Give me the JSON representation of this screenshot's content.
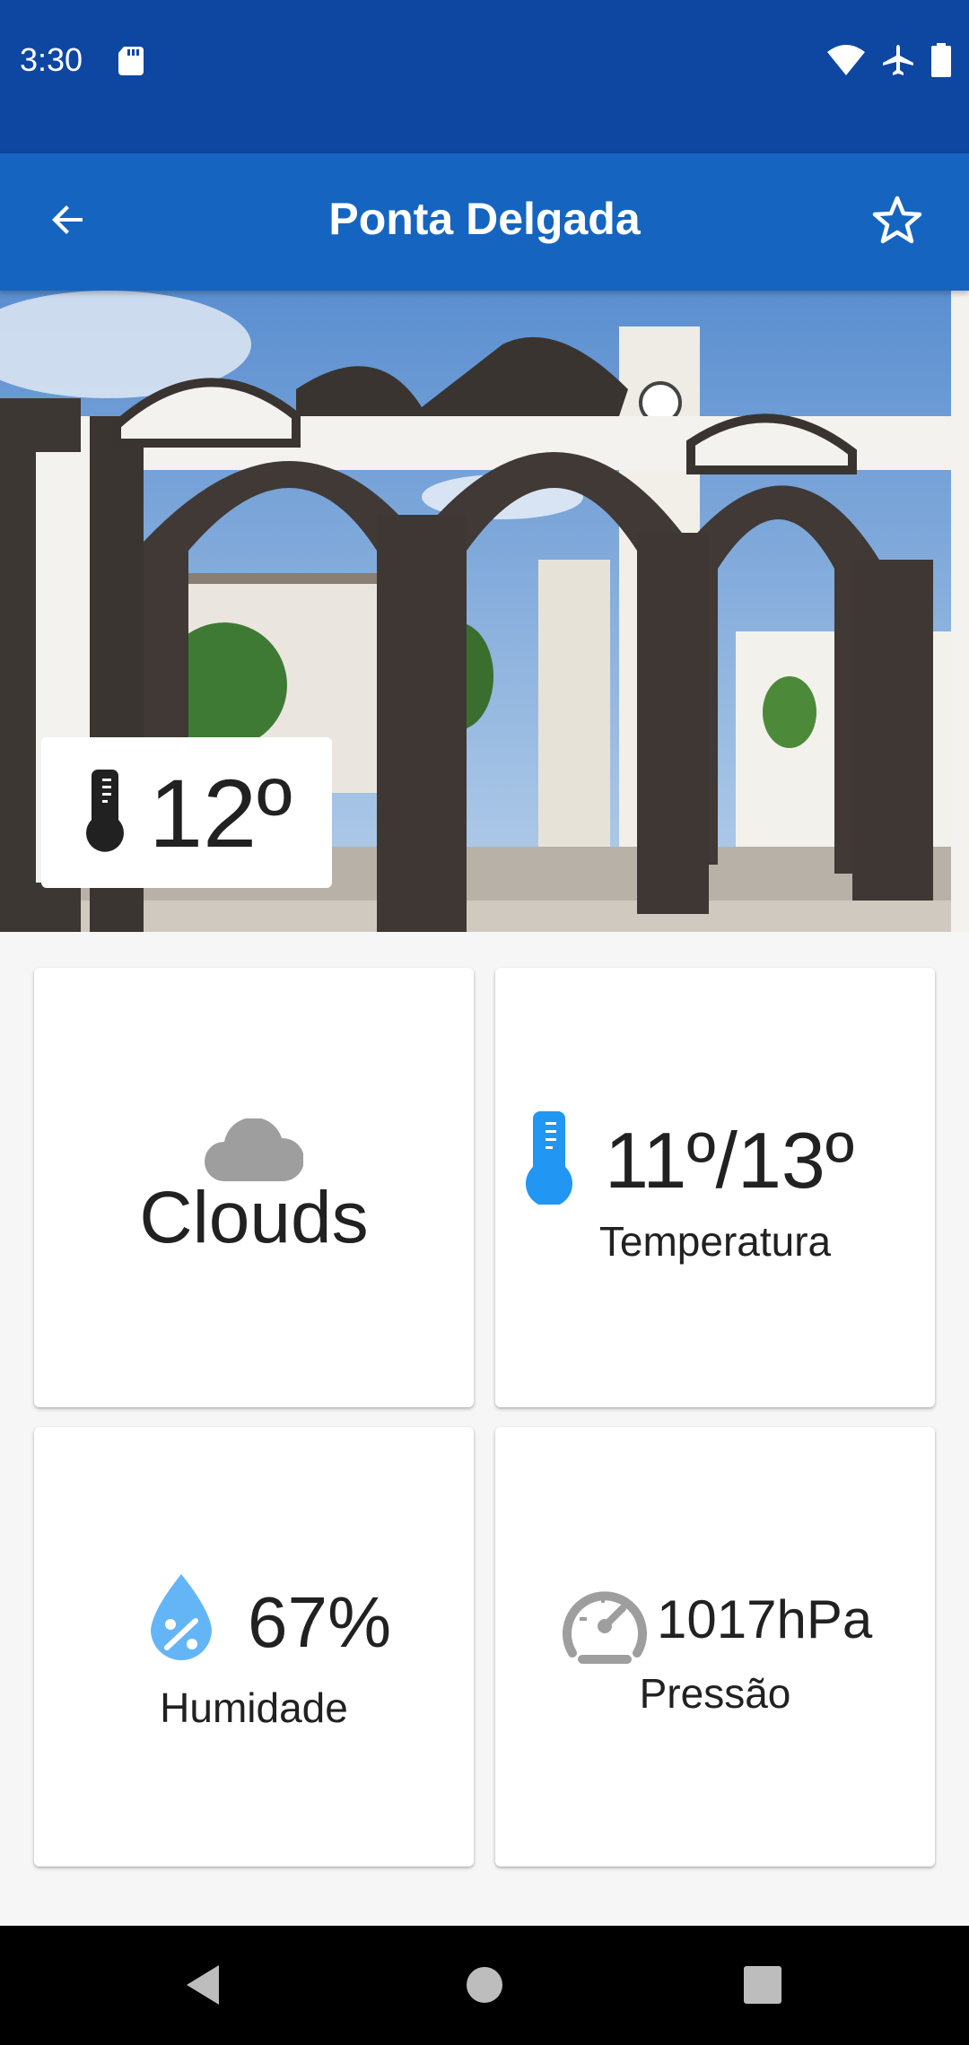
{
  "status_bar": {
    "time": "3:30",
    "icons": [
      "sd-card-icon",
      "wifi-icon",
      "airplane-icon",
      "battery-icon"
    ]
  },
  "app_bar": {
    "title": "Ponta Delgada",
    "back_icon": "arrow-back-icon",
    "favorite_icon": "star-outline-icon"
  },
  "hero": {
    "current_temperature": "12º",
    "temperature_icon": "thermometer-icon"
  },
  "cards": {
    "condition": {
      "label": "Clouds",
      "icon": "cloud-icon"
    },
    "temperature_range": {
      "value": "11º/13º",
      "label": "Temperatura",
      "icon": "thermometer-icon"
    },
    "humidity": {
      "value": "67%",
      "label": "Humidade",
      "icon": "water-percent-icon"
    },
    "pressure": {
      "value": "1017hPa",
      "label": "Pressão",
      "icon": "gauge-icon"
    }
  },
  "colors": {
    "status_bar": "#0d47a1",
    "app_bar": "#1565c0",
    "accent_blue": "#2196f3",
    "humidity_blue": "#64b5f6",
    "icon_gray": "#9e9e9e"
  },
  "nav_bar": {
    "buttons": [
      "nav-back-icon",
      "nav-home-icon",
      "nav-recents-icon"
    ]
  }
}
